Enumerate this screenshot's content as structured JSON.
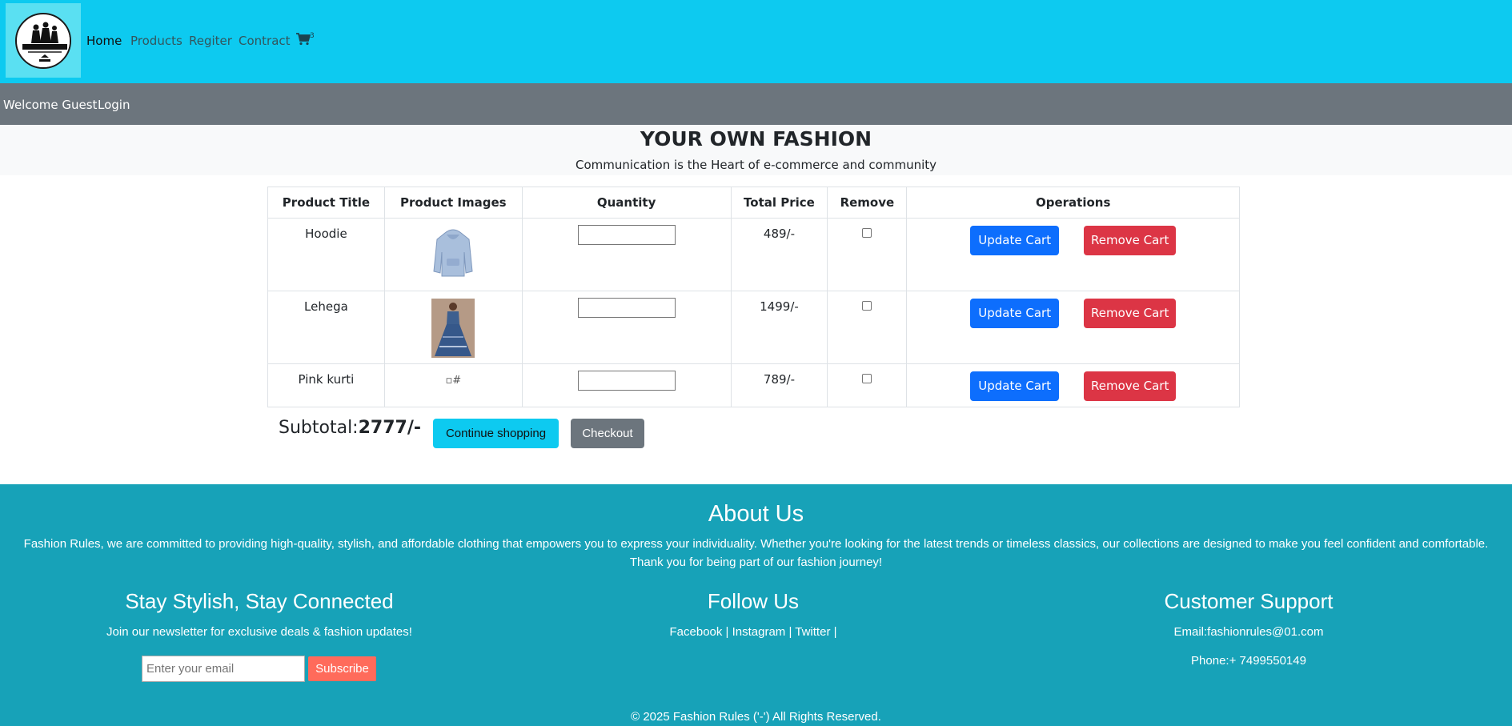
{
  "nav": {
    "links": [
      "Home",
      "Products",
      "Regiter",
      "Contract"
    ],
    "cart_count": "3"
  },
  "userbar": {
    "welcome": "Welcome Guest",
    "login": "Login"
  },
  "hero": {
    "title": "YOUR OWN FASHION",
    "subtitle": "Communication is the Heart of e-commerce and community"
  },
  "cart": {
    "headers": [
      "Product Title",
      "Product Images",
      "Quantity",
      "Total Price",
      "Remove",
      "Operations"
    ],
    "rows": [
      {
        "title": "Hoodie",
        "image_alt": "",
        "price": "489/-"
      },
      {
        "title": "Lehega",
        "image_alt": "",
        "price": "1499/-"
      },
      {
        "title": "Pink kurti",
        "image_alt": "#",
        "price": "789/-"
      }
    ],
    "update_label": "Update Cart",
    "remove_label": "Remove Cart",
    "subtotal_label": "Subtotal:",
    "subtotal_value": "2777/-",
    "continue_label": "Continue shopping",
    "checkout_label": "Checkout"
  },
  "footer": {
    "about_title": "About Us",
    "about_text_1": "Fashion Rules, we are committed to providing high-quality, stylish, and affordable clothing that empowers you to express your individuality. Whether you're looking for the latest trends or timeless classics, our collections are designed to make you feel confident and comfortable.",
    "about_text_2": "Thank you for being part of our fashion journey!",
    "newsletter_title": "Stay Stylish, Stay Connected",
    "newsletter_text": "Join our newsletter for exclusive deals & fashion updates!",
    "email_placeholder": "Enter your email",
    "subscribe_label": "Subscribe",
    "follow_title": "Follow Us",
    "follow_links": "Facebook | Instagram | Twitter |",
    "support_title": "Customer Support",
    "support_email": "Email:fashionrules@01.com",
    "support_phone": "Phone:+ 7499550149",
    "copyright": "© 2025 Fashion Rules ('-') All Rights Reserved."
  },
  "colors": {
    "navbar": "#0dcaf0",
    "userbar": "#6c757d",
    "footer": "#17a2b8",
    "primary": "#0d6efd",
    "danger": "#dc3545",
    "subscribe": "#ff6b5b"
  },
  "icons": [
    "logo-image",
    "cart-icon"
  ]
}
